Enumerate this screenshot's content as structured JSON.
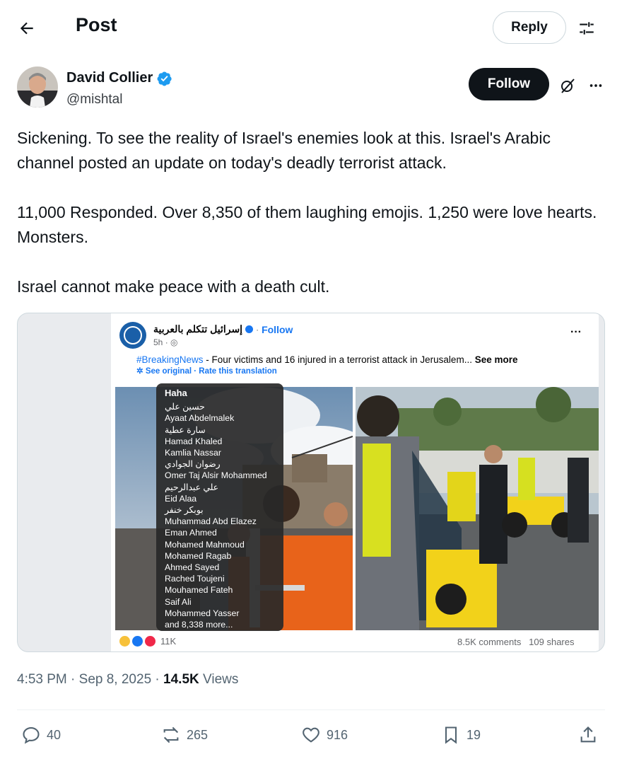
{
  "header": {
    "title": "Post",
    "reply_label": "Reply"
  },
  "author": {
    "name": "David Collier",
    "handle": "@mishtal",
    "follow_label": "Follow"
  },
  "tweet": {
    "paragraphs": [
      "Sickening. To see the reality of Israel's enemies look at this. Israel's Arabic channel posted an update on today's deadly terrorist attack.",
      "11,000 Responded. Over 8,350 of them laughing emojis. 1,250 were love hearts. Monsters.",
      "Israel cannot make peace with a death cult."
    ]
  },
  "embedded": {
    "page_name": "إسرائيل تتكلم بالعربية",
    "follow": "Follow",
    "time": "5h",
    "hashtag": "#BreakingNews",
    "text": " - Four victims and 16 injured in a terrorist attack in Jerusalem...",
    "see_more": "See more",
    "see_original": "See original",
    "rate": "Rate this translation",
    "tooltip_title": "Haha",
    "reactors": [
      "حسين علي",
      "Ayaat Abdelmalek",
      "سارة عطية",
      "Hamad Khaled",
      "Kamlia Nassar",
      "رضوان الجوادي",
      "Omer Taj Alsir Mohammed",
      "علي عبدالرحيم",
      "Eid Alaa",
      "بوبكر خنفر",
      "Muhammad Abd Elazez",
      "Eman Ahmed",
      "Mohamed Mahmoud",
      "Mohamed Ragab",
      "Ahmed Sayed",
      "Rached Toujeni",
      "Mouhamed Fateh",
      "Saif Ali",
      "Mohammed Yasser",
      "and 8,338 more..."
    ],
    "reactions_count": "11K",
    "comments": "8.5K comments",
    "shares": "109 shares"
  },
  "meta": {
    "time": "4:53 PM",
    "date": "Sep 8, 2025",
    "views_count": "14.5K",
    "views_label": "Views"
  },
  "actions": {
    "replies": "40",
    "reposts": "265",
    "likes": "916",
    "bookmarks": "19"
  },
  "colors": {
    "verified": "#1d9bf0",
    "follow_bg": "#0f1419",
    "fb_blue": "#1877f2"
  }
}
